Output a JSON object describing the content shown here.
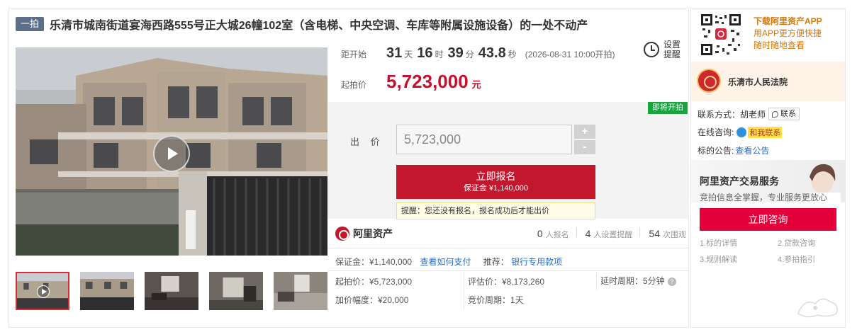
{
  "title": {
    "tag": "一拍",
    "text": "乐清市城南街道宴海西路555号正大城26幢102室（含电梯、中央空调、车库等附属设施设备）的一处不动产"
  },
  "countdown": {
    "label": "距开始",
    "days": "31",
    "days_unit": "天",
    "hours": "16",
    "hours_unit": "时",
    "minutes": "39",
    "minutes_unit": "分",
    "seconds": "43.8",
    "seconds_unit": "秒",
    "start_note": "(2026-08-31 10:00开拍)"
  },
  "remind": {
    "line1": "设置",
    "line2": "提醒"
  },
  "start_price": {
    "label": "起拍价",
    "value": "5,723,000",
    "unit": "元"
  },
  "bid": {
    "badge": "即将开拍",
    "label": "出 价",
    "input_value": "5,723,000",
    "plus": "+",
    "minus": "-",
    "signup_label": "立即报名",
    "signup_deposit": "保证金 ¥1,140,000",
    "tip": "提醒：您还没有报名，报名成功后才能出价"
  },
  "ali_bar": {
    "brand": "阿里资产",
    "signups": "0",
    "signups_label": "人报名",
    "reminders": "4",
    "reminders_label": "人设置提醒",
    "views": "54",
    "views_label": "次围观"
  },
  "info": {
    "deposit": "保证金：¥1,140,000",
    "deposit_link": "查看如何支付",
    "recommend": "推荐：",
    "recommend_link": "银行专用款项",
    "start_price": "起拍价：¥5,723,000",
    "appraisal": "评估价：¥8,173,260",
    "delay": "延时周期：5分钟",
    "increment": "加价幅度：¥20,000",
    "cycle": "竞价周期：1天"
  },
  "side": {
    "app_title": "下载阿里资产APP",
    "app_sub1": "用APP更方便快捷",
    "app_sub2": "随时随地查看",
    "court_name": "乐清市人民法院",
    "contact_label": "联系方式：胡老师",
    "contact_btn": "联系",
    "online_label": "在线咨询:",
    "online_btn": "和我联系",
    "notice_label": "标的公告:",
    "notice_link": "查看公告",
    "service_title": "阿里资产交易服务",
    "service_sub": "竞拍信息全掌握，专业服务更放心",
    "consult_btn": "立即咨询",
    "guides": [
      "1.标的详情",
      "2.贷款咨询",
      "3.规则解读",
      "4.参拍指引"
    ]
  },
  "colors": {
    "price_red": "#c8102e",
    "signup_red": "#c3172d",
    "badge_green": "#1aa33f",
    "link_blue": "#2670c8",
    "app_orange": "#d4770a"
  }
}
